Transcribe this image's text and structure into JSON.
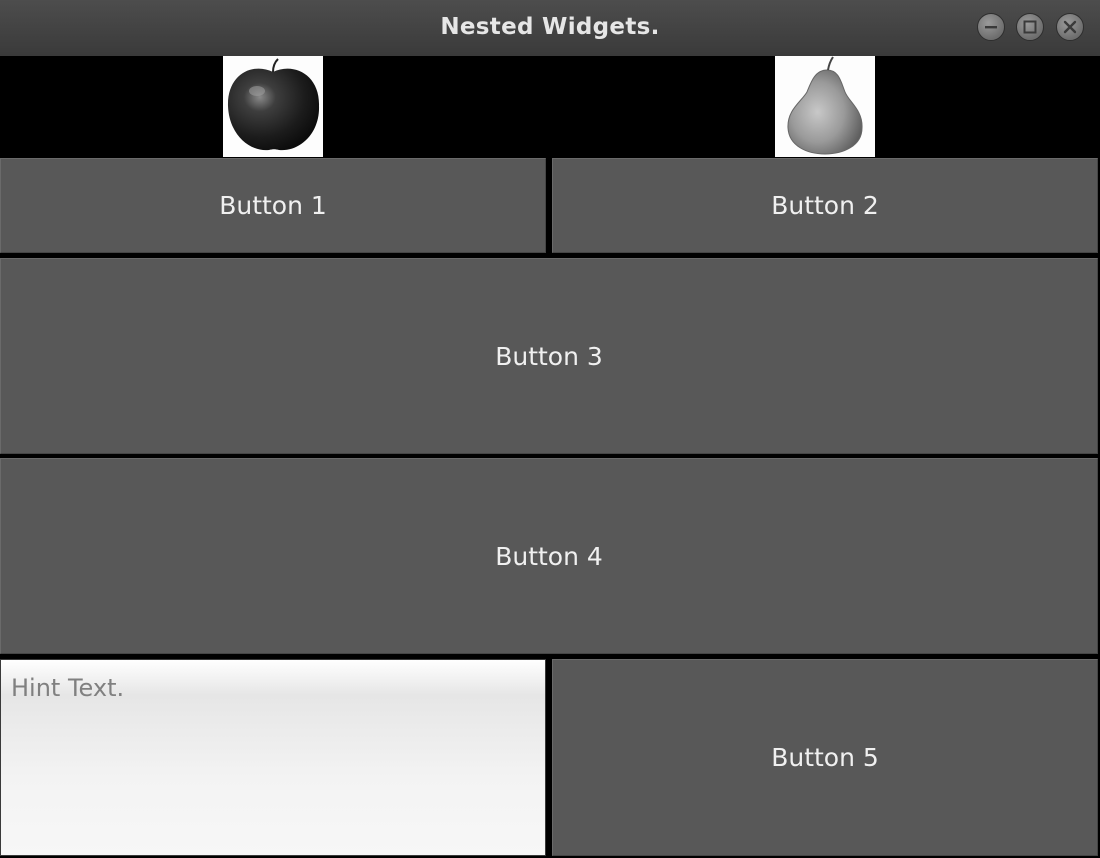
{
  "window": {
    "title": "Nested Widgets."
  },
  "titlebar_buttons": [
    "minimize-icon",
    "maximize-icon",
    "close-icon"
  ],
  "images": [
    {
      "name": "apple",
      "icon": "apple-image"
    },
    {
      "name": "pear",
      "icon": "pear-image"
    }
  ],
  "buttons": {
    "b1": "Button 1",
    "b2": "Button 2",
    "b3": "Button 3",
    "b4": "Button 4",
    "b5": "Button 5"
  },
  "text_input": {
    "placeholder": "Hint Text.",
    "value": ""
  },
  "colors": {
    "button_bg": "#585858",
    "button_text": "#f0f0f0",
    "background": "#000000"
  }
}
